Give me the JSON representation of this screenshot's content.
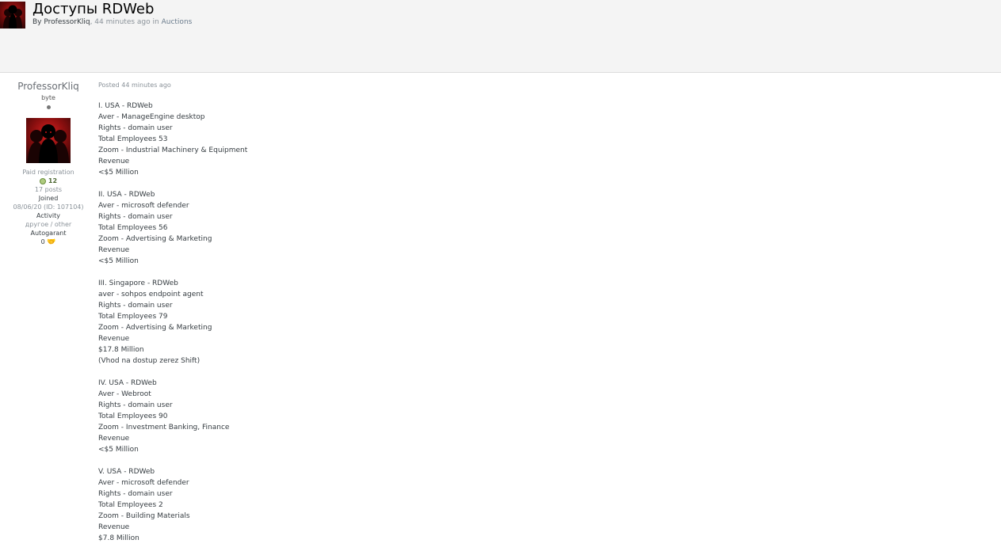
{
  "topic": {
    "title": "Доступы RDWeb",
    "by_label": "By",
    "author": "ProfessorKliq",
    "time": ", 44 minutes ago in",
    "forum": "Auctions"
  },
  "author_panel": {
    "name": "ProfessorKliq",
    "rank": "byte",
    "group": "Paid registration",
    "reputation": "12",
    "posts": "17 posts",
    "joined_label": "Joined",
    "joined_value": "08/06/20 (ID: 107104)",
    "activity_label": "Activity",
    "activity_value": "другое / other",
    "autogarant_label": "Autogarant",
    "autogarant_value": "0",
    "garant_icon": "handshake-icon"
  },
  "post": {
    "date": "Posted 44 minutes ago",
    "blocks": [
      [
        "I. USA - RDWeb",
        "Aver - ManageEngine desktop",
        "Rights - domain user",
        "Total Employees 53",
        "Zoom - Industrial Machinery & Equipment",
        "Revenue",
        "<$5 Million"
      ],
      [
        "II. USA - RDWeb",
        "Aver - microsoft defender",
        "Rights - domain user",
        "Total Employees 56",
        "Zoom - Advertising & Marketing",
        "Revenue",
        "<$5 Million"
      ],
      [
        "III. Singapore - RDWeb",
        "aver - sohpos endpoint agent",
        "Rights - domain user",
        "Total Employees 79",
        "Zoom - Advertising & Marketing",
        "Revenue",
        "$17.8 Million",
        "(Vhod na dostup zerez Shift)"
      ],
      [
        "IV. USA - RDWeb",
        "Aver - Webroot",
        "Rights - domain user",
        "Total Employees 90",
        "Zoom - Investment Banking, Finance",
        "Revenue",
        "<$5 Million"
      ],
      [
        "V. USA - RDWeb",
        "Aver - microsoft defender",
        "Rights - domain user",
        "Total Employees 2",
        "Zoom - Building Materials",
        "Revenue",
        "$7.8 Million"
      ]
    ]
  }
}
